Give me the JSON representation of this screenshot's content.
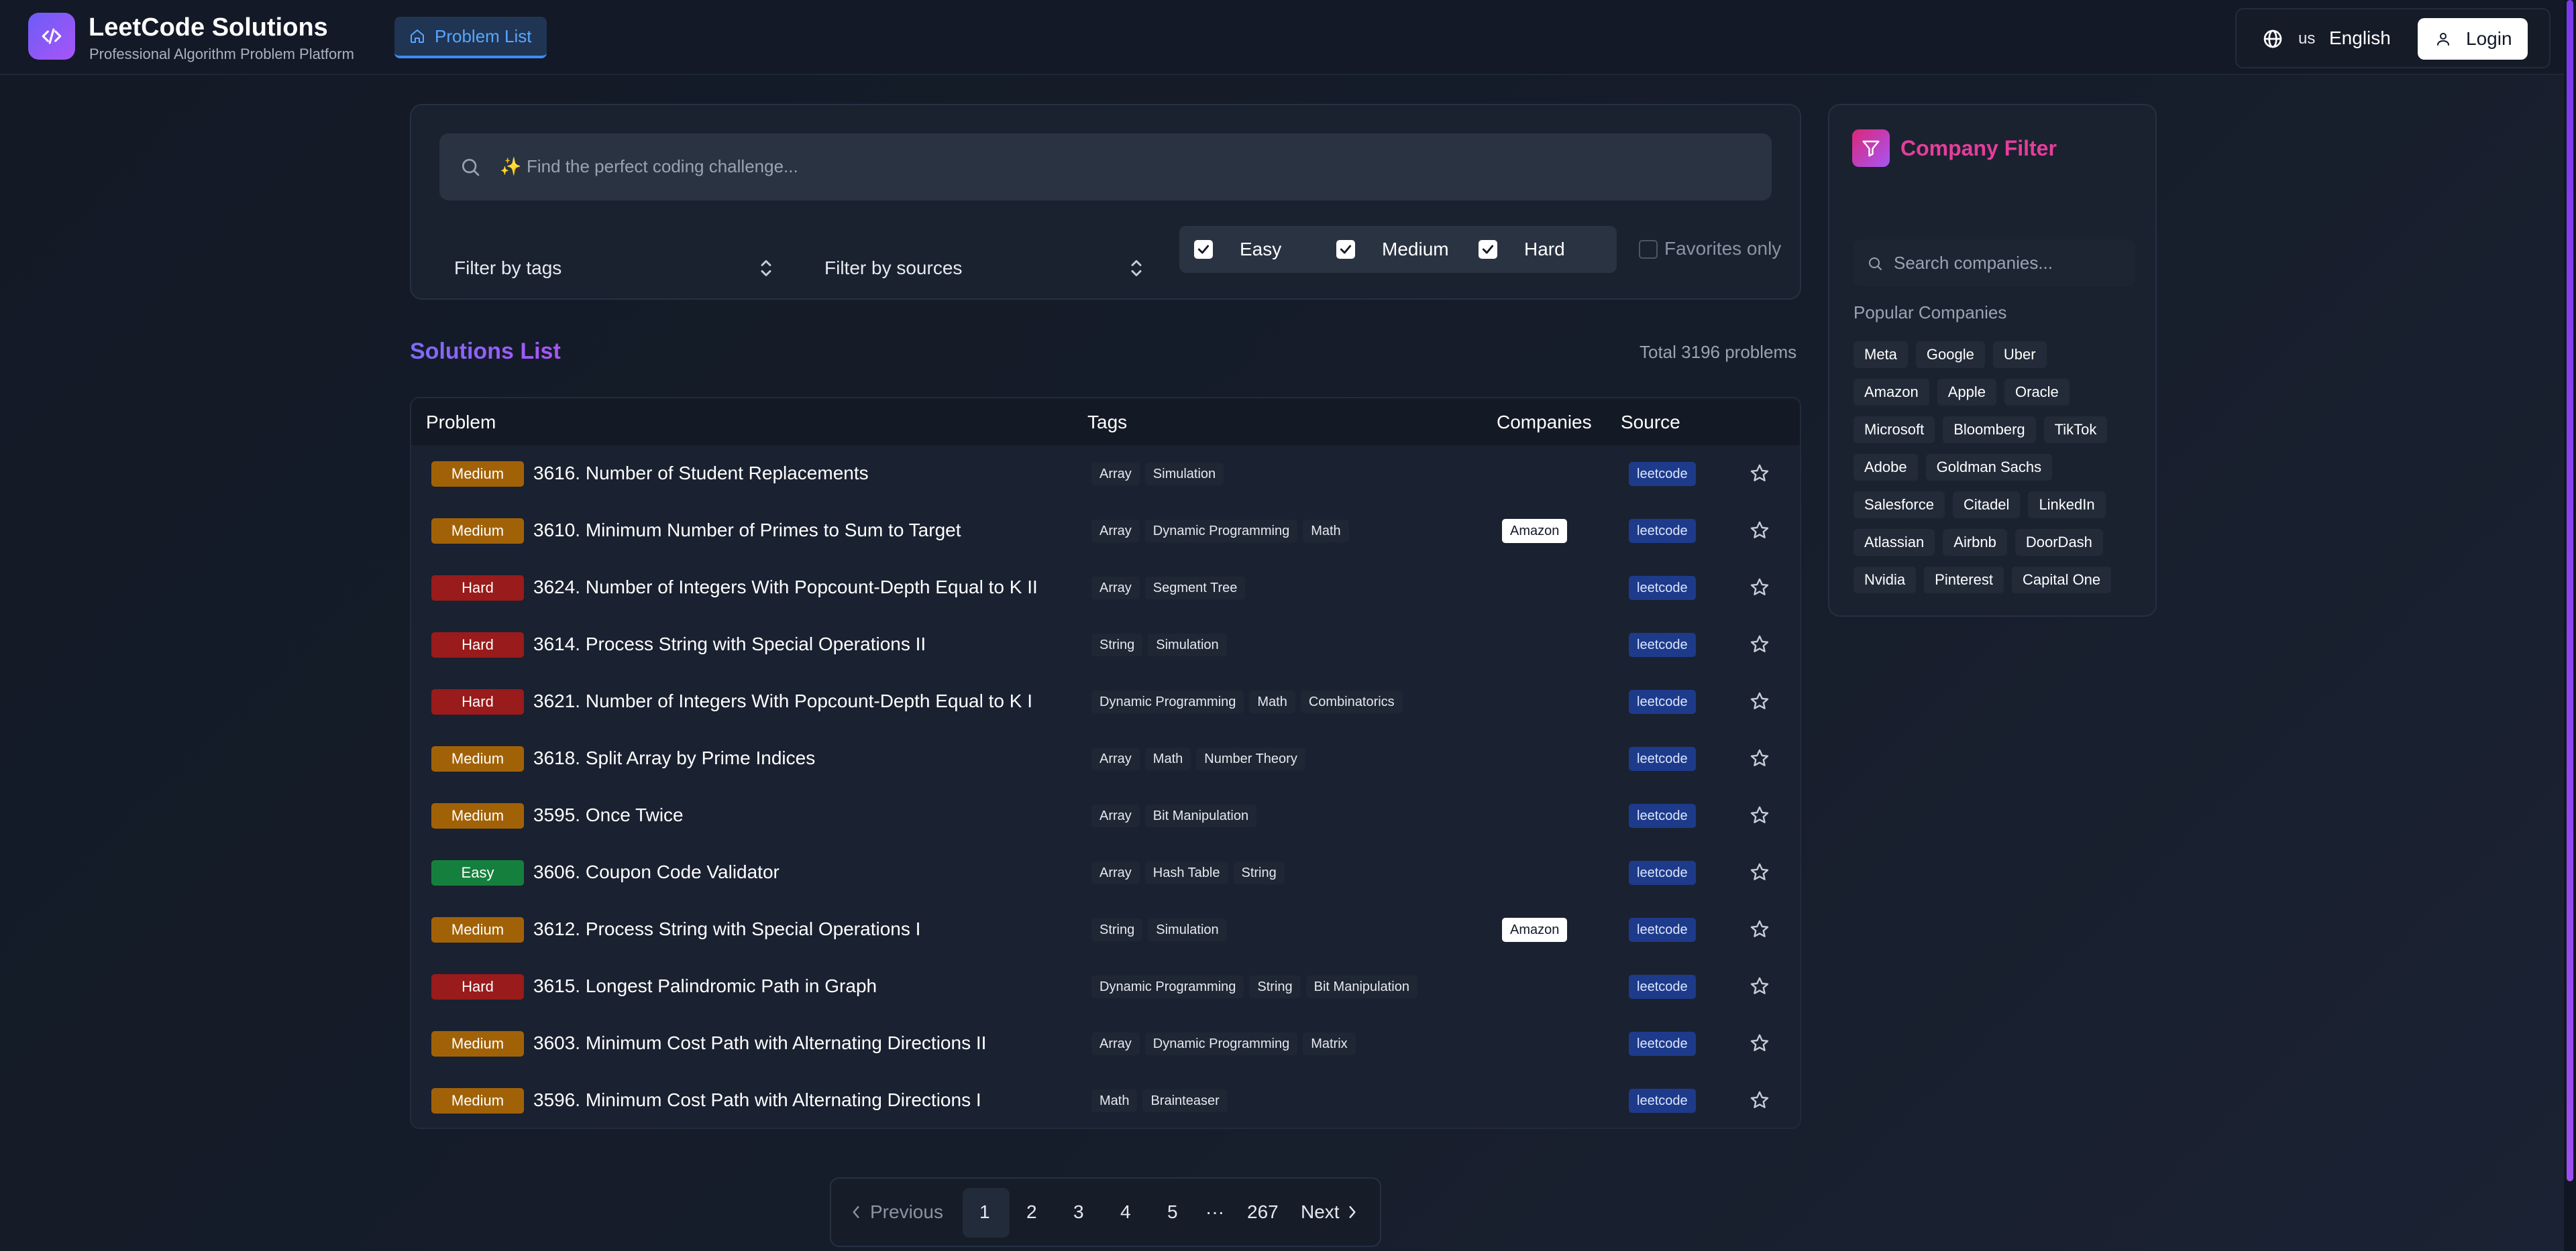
{
  "header": {
    "brand_title": "LeetCode Solutions",
    "brand_subtitle": "Professional Algorithm Problem Platform",
    "nav_tab": "Problem List",
    "lang_code": "us",
    "lang_name": "English",
    "login": "Login",
    "icons": {
      "logo": "code-icon",
      "nav": "home-icon",
      "lang": "globe-icon",
      "login": "user-icon"
    }
  },
  "filters": {
    "search_placeholder": "Find the perfect coding challenge...",
    "spark": "✨",
    "tags_select": "Filter by tags",
    "sources_select": "Filter by sources",
    "difficulty": [
      {
        "label": "Easy",
        "checked": true
      },
      {
        "label": "Medium",
        "checked": true
      },
      {
        "label": "Hard",
        "checked": true
      }
    ],
    "favorites": {
      "label": "Favorites only",
      "checked": false
    }
  },
  "list": {
    "title": "Solutions List",
    "total": "Total 3196 problems",
    "columns": [
      "Problem",
      "Tags",
      "Companies",
      "Source"
    ],
    "difficulty_colors": {
      "Medium": "#a16207",
      "Hard": "#991b1b",
      "Easy": "#15803d"
    },
    "rows": [
      {
        "difficulty": "Medium",
        "title": "3616. Number of Student Replacements",
        "tags": [
          "Array",
          "Simulation"
        ],
        "company": "",
        "source": "leetcode"
      },
      {
        "difficulty": "Medium",
        "title": "3610. Minimum Number of Primes to Sum to Target",
        "tags": [
          "Array",
          "Dynamic Programming",
          "Math"
        ],
        "company": "Amazon",
        "source": "leetcode"
      },
      {
        "difficulty": "Hard",
        "title": "3624. Number of Integers With Popcount-Depth Equal to K II",
        "tags": [
          "Array",
          "Segment Tree"
        ],
        "company": "",
        "source": "leetcode"
      },
      {
        "difficulty": "Hard",
        "title": "3614. Process String with Special Operations II",
        "tags": [
          "String",
          "Simulation"
        ],
        "company": "",
        "source": "leetcode"
      },
      {
        "difficulty": "Hard",
        "title": "3621. Number of Integers With Popcount-Depth Equal to K I",
        "tags": [
          "Dynamic Programming",
          "Math",
          "Combinatorics"
        ],
        "company": "",
        "source": "leetcode"
      },
      {
        "difficulty": "Medium",
        "title": "3618. Split Array by Prime Indices",
        "tags": [
          "Array",
          "Math",
          "Number Theory"
        ],
        "company": "",
        "source": "leetcode"
      },
      {
        "difficulty": "Medium",
        "title": "3595. Once Twice",
        "tags": [
          "Array",
          "Bit Manipulation"
        ],
        "company": "",
        "source": "leetcode"
      },
      {
        "difficulty": "Easy",
        "title": "3606. Coupon Code Validator",
        "tags": [
          "Array",
          "Hash Table",
          "String"
        ],
        "company": "",
        "source": "leetcode"
      },
      {
        "difficulty": "Medium",
        "title": "3612. Process String with Special Operations I",
        "tags": [
          "String",
          "Simulation"
        ],
        "company": "Amazon",
        "source": "leetcode"
      },
      {
        "difficulty": "Hard",
        "title": "3615. Longest Palindromic Path in Graph",
        "tags": [
          "Dynamic Programming",
          "String",
          "Bit Manipulation"
        ],
        "company": "",
        "source": "leetcode"
      },
      {
        "difficulty": "Medium",
        "title": "3603. Minimum Cost Path with Alternating Directions II",
        "tags": [
          "Array",
          "Dynamic Programming",
          "Matrix"
        ],
        "company": "",
        "source": "leetcode"
      },
      {
        "difficulty": "Medium",
        "title": "3596. Minimum Cost Path with Alternating Directions I",
        "tags": [
          "Math",
          "Brainteaser"
        ],
        "company": "",
        "source": "leetcode"
      }
    ]
  },
  "pagination": {
    "previous": "Previous",
    "pages": [
      "1",
      "2",
      "3",
      "4",
      "5"
    ],
    "ellipsis": "···",
    "last": "267",
    "next": "Next",
    "current": "1"
  },
  "company_filter": {
    "title": "Company Filter",
    "search_placeholder": "Search companies...",
    "popular_label": "Popular Companies",
    "companies": [
      [
        "Meta",
        "Google",
        "Uber"
      ],
      [
        "Amazon",
        "Apple",
        "Oracle"
      ],
      [
        "Microsoft",
        "Bloomberg",
        "TikTok"
      ],
      [
        "Adobe",
        "Goldman Sachs"
      ],
      [
        "Salesforce",
        "Citadel",
        "LinkedIn"
      ],
      [
        "Atlassian",
        "Airbnb",
        "DoorDash"
      ],
      [
        "Nvidia",
        "Pinterest",
        "Capital One"
      ]
    ]
  }
}
